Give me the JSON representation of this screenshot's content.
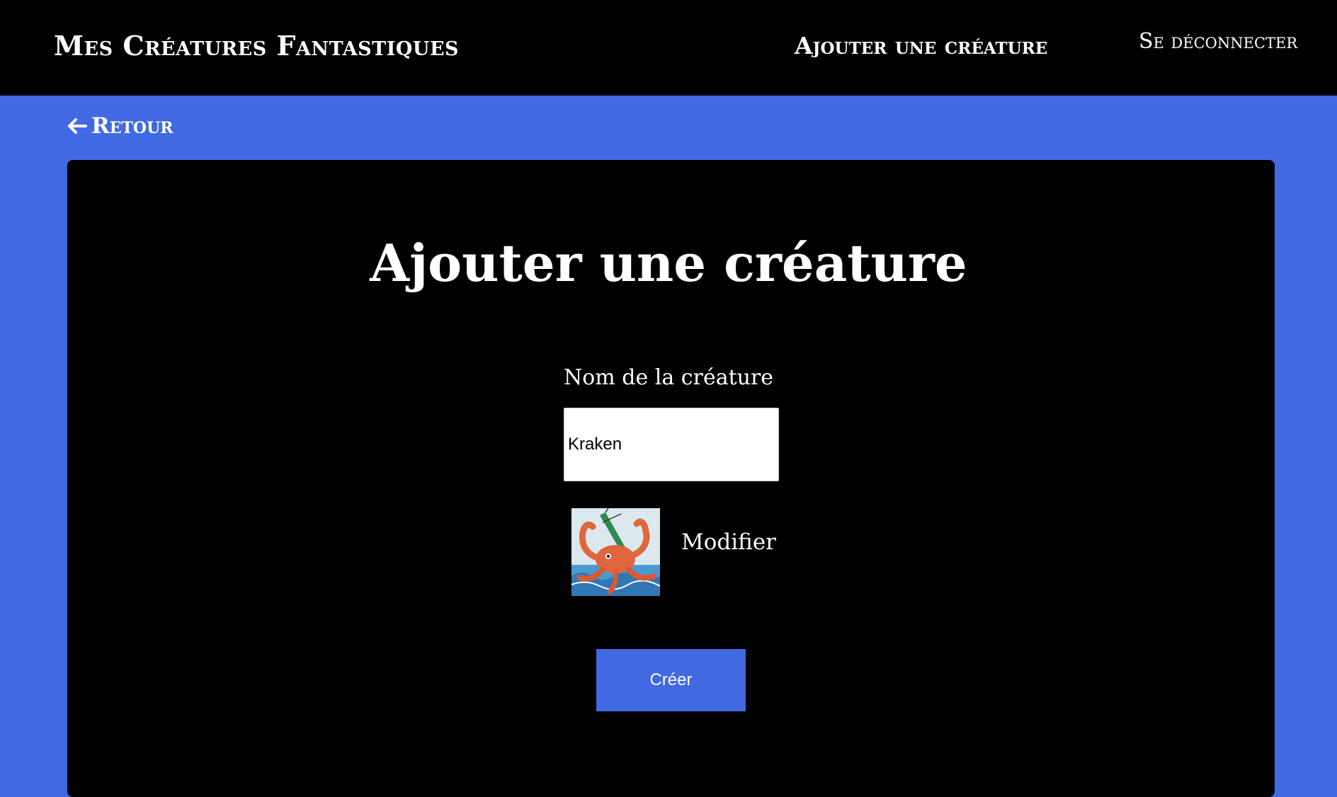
{
  "header": {
    "brand": "Mes Créatures Fantastiques",
    "nav_add": "Ajouter une créature",
    "nav_logout": "Se déconnecter"
  },
  "back": {
    "label": "Retour",
    "icon": "arrow-left-icon"
  },
  "form": {
    "title": "Ajouter une créature",
    "name_label": "Nom de la créature",
    "name_value": "Kraken",
    "image_alt": "Kraken",
    "modify_label": "Modifier",
    "submit_label": "Créer"
  },
  "colors": {
    "accent": "#4169e1",
    "background": "#000000",
    "text": "#ffffff"
  }
}
